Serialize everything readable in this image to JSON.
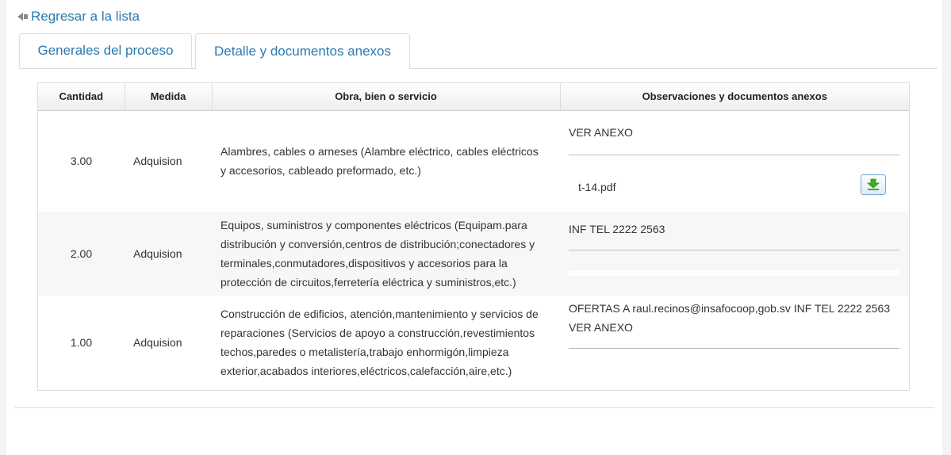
{
  "nav": {
    "back_label": "Regresar a la lista"
  },
  "tabs": [
    {
      "label": "Generales del proceso"
    },
    {
      "label": "Detalle y documentos anexos"
    }
  ],
  "table": {
    "headers": [
      "Cantidad",
      "Medida",
      "Obra, bien o servicio",
      "Observaciones y documentos anexos"
    ],
    "rows": [
      {
        "cantidad": "3.00",
        "medida": "Adquision",
        "obra": "Alambres, cables o arneses (Alambre eléctrico, cables eléctricos y accesorios, cableado preformado, etc.)",
        "observaciones": "VER ANEXO",
        "file": "t-14.pdf"
      },
      {
        "cantidad": "2.00",
        "medida": "Adquision",
        "obra": "Equipos, suministros y componentes eléctricos (Equipam.para distribución y conversión,centros de distribución;conectadores y terminales,conmutadores,dispositivos y accesorios para la protección de circuitos,ferretería eléctrica y suministros,etc.)",
        "observaciones": "INF TEL 2222 2563"
      },
      {
        "cantidad": "1.00",
        "medida": "Adquision",
        "obra": "Construcción de edificios, atención,mantenimiento y servicios de reparaciones (Servicios de apoyo a construcción,revestimientos techos,paredes o metalistería,trabajo enhormigón,limpieza exterior,acabados interiores,eléctricos,calefacción,aire,etc.)",
        "observaciones": "OFERTAS A raul.recinos@insafocoop,gob.sv INF TEL 2222 2563 VER ANEXO"
      }
    ]
  },
  "icons": {
    "back": "arrow-left-icon",
    "download": "download-icon"
  },
  "colors": {
    "link": "#2a7ab0",
    "download_green": "#3cb015"
  }
}
